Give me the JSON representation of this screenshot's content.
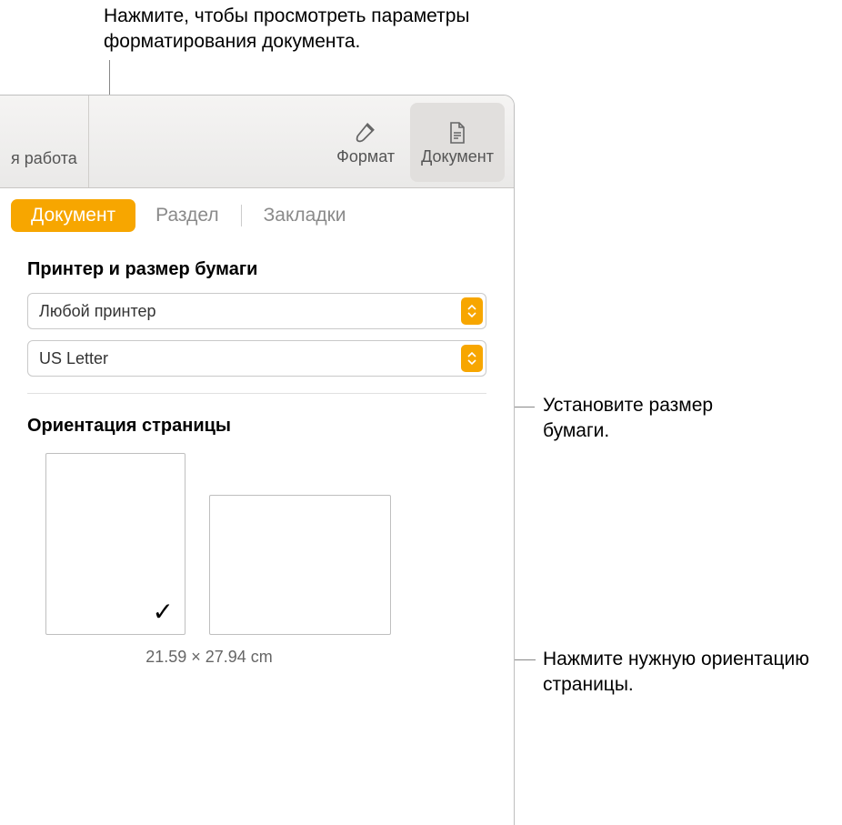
{
  "annotations": {
    "top": "Нажмите, чтобы просмотреть параметры форматирования документа.",
    "paper": "Установите размер бумаги.",
    "orientation": "Нажмите нужную ориентацию страницы."
  },
  "toolbar": {
    "partial_item": "я работа",
    "format_label": "Формат",
    "document_label": "Документ"
  },
  "sidebar_tabs": {
    "document": "Документ",
    "section": "Раздел",
    "bookmarks": "Закладки"
  },
  "panel": {
    "printer_section_title": "Принтер и размер бумаги",
    "printer_value": "Любой принтер",
    "paper_value": "US Letter",
    "orientation_title": "Ориентация страницы",
    "dimensions": "21.59 × 27.94 cm",
    "check": "✓"
  }
}
